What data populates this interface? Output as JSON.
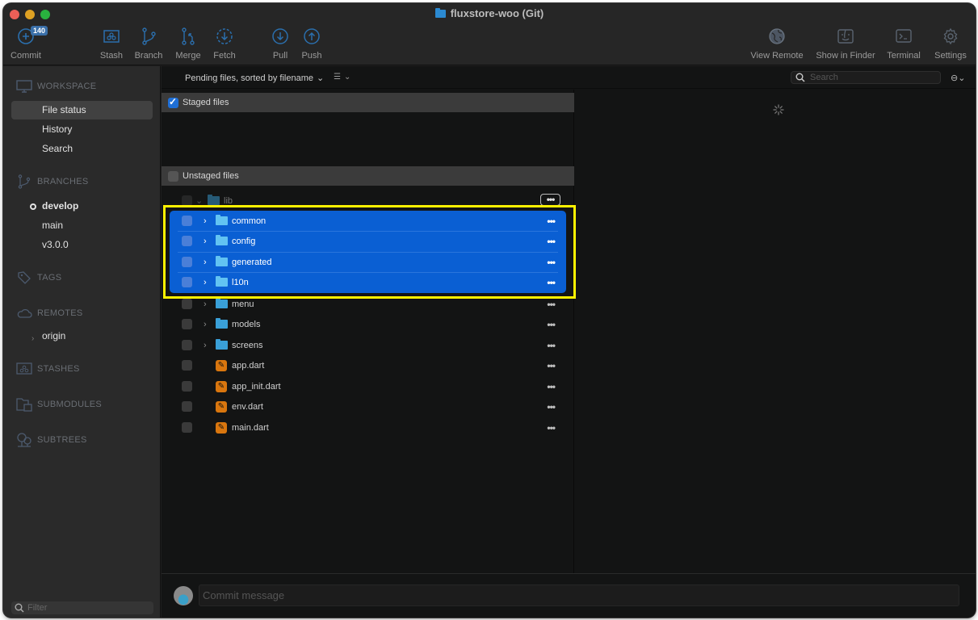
{
  "window": {
    "title": "fluxstore-woo (Git)"
  },
  "toolbar": {
    "commit": {
      "label": "Commit",
      "badge": "140"
    },
    "stash": {
      "label": "Stash"
    },
    "branch": {
      "label": "Branch"
    },
    "merge": {
      "label": "Merge"
    },
    "fetch": {
      "label": "Fetch"
    },
    "pull": {
      "label": "Pull"
    },
    "push": {
      "label": "Push"
    },
    "view_remote": {
      "label": "View Remote"
    },
    "show_in_finder": {
      "label": "Show in Finder"
    },
    "terminal": {
      "label": "Terminal"
    },
    "settings": {
      "label": "Settings"
    }
  },
  "sidebar": {
    "workspace": {
      "header": "WORKSPACE",
      "items": [
        "File status",
        "History",
        "Search"
      ],
      "selected": "File status"
    },
    "branches": {
      "header": "BRANCHES",
      "items": [
        "develop",
        "main",
        "v3.0.0"
      ],
      "current": "develop"
    },
    "tags": {
      "header": "TAGS"
    },
    "remotes": {
      "header": "REMOTES",
      "items": [
        "origin"
      ]
    },
    "stashes": {
      "header": "STASHES"
    },
    "submodules": {
      "header": "SUBMODULES"
    },
    "subtrees": {
      "header": "SUBTREES"
    },
    "filter_placeholder": "Filter"
  },
  "file_list": {
    "sort_label": "Pending files, sorted by filename",
    "search_placeholder": "Search",
    "staged": {
      "label": "Staged files",
      "checked": true
    },
    "unstaged": {
      "label": "Unstaged files",
      "checked": false
    },
    "root": {
      "name": "lib",
      "expanded": true
    },
    "selected_rows": [
      {
        "name": "common",
        "type": "folder"
      },
      {
        "name": "config",
        "type": "folder"
      },
      {
        "name": "generated",
        "type": "folder"
      },
      {
        "name": "l10n",
        "type": "folder"
      }
    ],
    "rows": [
      {
        "name": "menu",
        "type": "folder"
      },
      {
        "name": "models",
        "type": "folder"
      },
      {
        "name": "screens",
        "type": "folder"
      },
      {
        "name": "app.dart",
        "type": "file"
      },
      {
        "name": "app_init.dart",
        "type": "file"
      },
      {
        "name": "env.dart",
        "type": "file"
      },
      {
        "name": "main.dart",
        "type": "file"
      }
    ],
    "more_label": "•••"
  },
  "commit_bar": {
    "placeholder": "Commit message"
  },
  "colors": {
    "selection": "#0a5fd3",
    "highlight": "#fff200",
    "accent": "#2b8ad2",
    "file_modified": "#d9760e"
  }
}
